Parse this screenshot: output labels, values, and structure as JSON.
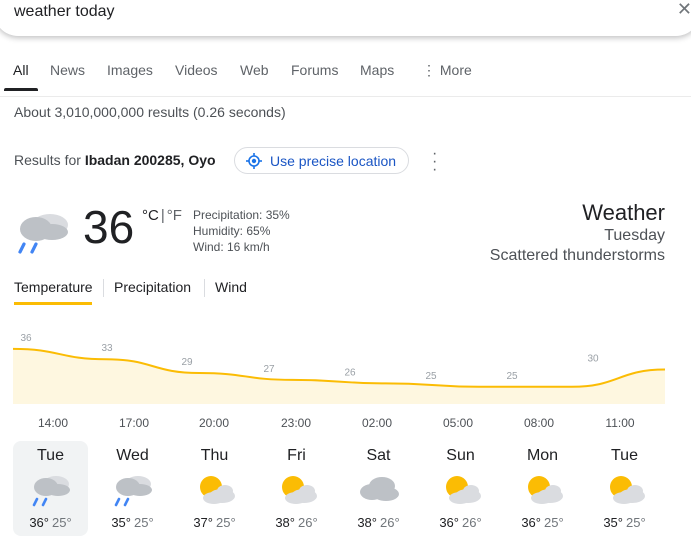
{
  "search": {
    "query": "weather today",
    "clear_icon": "close-icon"
  },
  "tabs": [
    {
      "label": "All",
      "active": true
    },
    {
      "label": "Images"
    },
    {
      "label": "News"
    },
    {
      "label": "Videos"
    },
    {
      "label": "Web"
    },
    {
      "label": "Forums"
    },
    {
      "label": "Maps"
    },
    {
      "label": "More",
      "icon": "kebab-icon"
    }
  ],
  "results_stats": "About 3,010,000,000 results (0.26 seconds)",
  "location": {
    "prefix": "Results for",
    "place": "Ibadan 200285, Oyo",
    "precise_button": "Use precise location"
  },
  "current": {
    "icon": "thunderstorm-icon",
    "temperature": "36",
    "unit_c": "°C",
    "unit_sep": "|",
    "unit_f": "°F",
    "precipitation": "Precipitation: 35%",
    "humidity": "Humidity: 65%",
    "wind": "Wind: 16 km/h",
    "title": "Weather",
    "day": "Tuesday",
    "condition": "Scattered thunderstorms"
  },
  "weather_tabs": [
    "Temperature",
    "Precipitation",
    "Wind"
  ],
  "colors": {
    "accent_yellow": "#fbbc04",
    "chart_fill": "#fef7e0",
    "link_blue": "#1a55c4"
  },
  "chart_data": {
    "type": "area",
    "categories": [
      "14:00",
      "17:00",
      "20:00",
      "23:00",
      "02:00",
      "05:00",
      "08:00",
      "11:00"
    ],
    "values": [
      36,
      33,
      29,
      27,
      26,
      25,
      25,
      30
    ],
    "ylim": [
      20,
      38
    ],
    "grid": false
  },
  "forecast": [
    {
      "day": "Tue",
      "icon": "thunderstorm-icon",
      "high": "36°",
      "low": "25°",
      "selected": true
    },
    {
      "day": "Wed",
      "icon": "thunderstorm-icon",
      "high": "35°",
      "low": "25°"
    },
    {
      "day": "Thu",
      "icon": "partly-cloudy-icon",
      "high": "37°",
      "low": "25°"
    },
    {
      "day": "Fri",
      "icon": "partly-cloudy-icon",
      "high": "38°",
      "low": "26°"
    },
    {
      "day": "Sat",
      "icon": "cloudy-icon",
      "high": "38°",
      "low": "26°"
    },
    {
      "day": "Sun",
      "icon": "partly-cloudy-icon",
      "high": "36°",
      "low": "26°"
    },
    {
      "day": "Mon",
      "icon": "partly-cloudy-icon",
      "high": "36°",
      "low": "25°"
    },
    {
      "day": "Tue",
      "icon": "partly-cloudy-icon",
      "high": "35°",
      "low": "25°"
    }
  ]
}
